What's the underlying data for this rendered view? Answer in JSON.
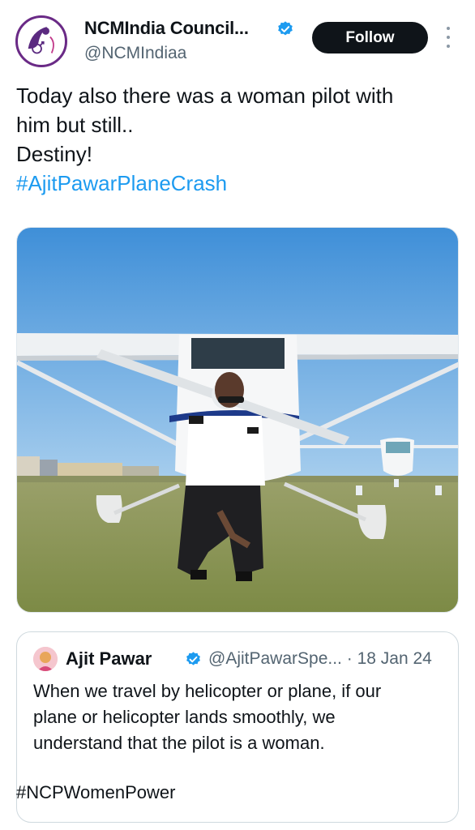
{
  "author": {
    "display_name": "NCMIndia Council...",
    "handle": "@NCMIndiaa",
    "verified": true,
    "avatar_icon": "ncm-logo-icon"
  },
  "actions": {
    "follow_label": "Follow",
    "more_icon": "more-vertical-icon"
  },
  "tweet": {
    "lines": [
      "Today also there was a woman pilot with",
      "him but still..",
      "Destiny!"
    ],
    "hashtag": "#AjitPawarPlaneCrash"
  },
  "media": {
    "description_icon": "photo-icon"
  },
  "quoted_tweet": {
    "display_name": "Ajit Pawar",
    "handle": "@AjitPawarSpe...",
    "separator": "·",
    "date": "18 Jan 24",
    "lines": [
      "When we travel by helicopter or plane, if our",
      "plane or helicopter lands smoothly, we",
      "understand that the pilot is a woman."
    ],
    "hashtag": "#NCPWomenPower"
  },
  "colors": {
    "link": "#1d9bf0",
    "text": "#0f1419",
    "secondary": "#536471",
    "verified": "#1d9bf0",
    "follow_bg": "#0f1419"
  }
}
